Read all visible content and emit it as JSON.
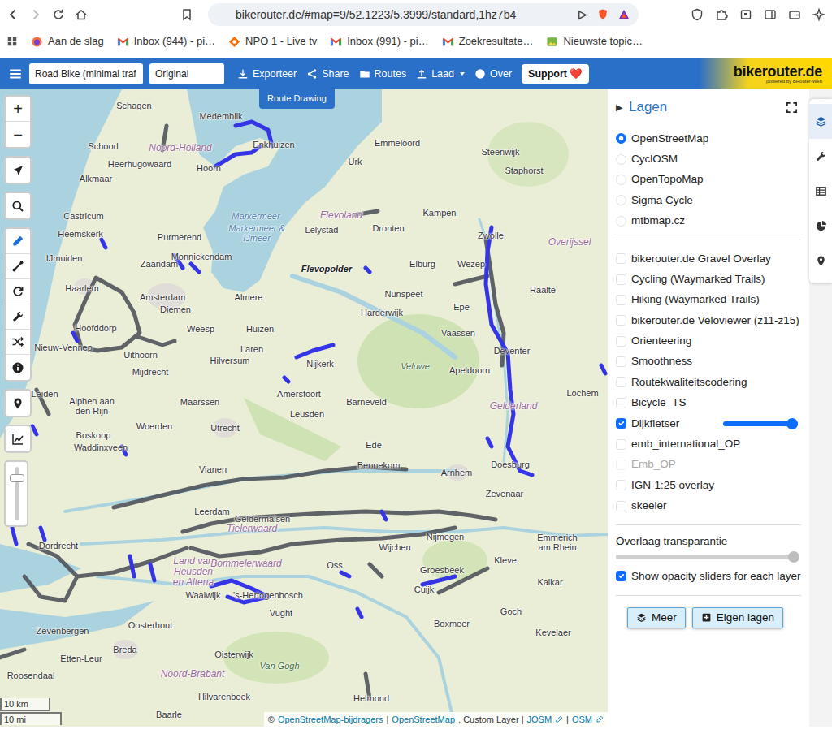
{
  "browser": {
    "url": "bikerouter.de/#map=9/52.1223/5.3999/standard,1hz7b4",
    "bookmarks": [
      {
        "label": "Aan de slag",
        "kind": "firefox"
      },
      {
        "label": "Inbox (944) - pi…",
        "kind": "gmail"
      },
      {
        "label": "NPO 1 - Live tv",
        "kind": "npo"
      },
      {
        "label": "Inbox (991) - pi…",
        "kind": "gmail"
      },
      {
        "label": "Zoekresultate…",
        "kind": "gmail"
      },
      {
        "label": "Nieuwste topic…",
        "kind": "forum"
      }
    ]
  },
  "toolbar": {
    "profile": "Road Bike (minimal traf",
    "style": "Original",
    "menu": [
      {
        "label": "Exporteer"
      },
      {
        "label": "Share"
      },
      {
        "label": "Routes"
      },
      {
        "label": "Laad"
      },
      {
        "label": "Over"
      }
    ],
    "support": "Support",
    "support_icon": "❤️",
    "logo": "bikerouter.de",
    "logo_sub": "powered by BRouter-Web"
  },
  "route_drawing": "Route Drawing",
  "map": {
    "zoom_in": "+",
    "zoom_out": "−",
    "zoom_slider": {
      "level": 0.8
    },
    "draw_tools": [
      {
        "selected": true
      },
      {
        "selected": false
      },
      {
        "selected": false
      },
      {
        "selected": false
      },
      {
        "selected": false
      },
      {
        "selected": false
      }
    ],
    "labels": [
      {
        "text": "Schagen",
        "kind": "place"
      },
      {
        "text": "Medemblik",
        "kind": "place"
      },
      {
        "text": "Enkhuizen",
        "kind": "place"
      },
      {
        "text": "Steenwijk",
        "kind": "place"
      },
      {
        "text": "Schoorl",
        "kind": "place"
      },
      {
        "text": "Noord-Holland",
        "kind": "region"
      },
      {
        "text": "Hoorn",
        "kind": "place"
      },
      {
        "text": "Emmeloord",
        "kind": "place"
      },
      {
        "text": "Urk",
        "kind": "place"
      },
      {
        "text": "Staphorst",
        "kind": "place"
      },
      {
        "text": "Heerhugowaard",
        "kind": "place"
      },
      {
        "text": "Alkmaar",
        "kind": "place"
      },
      {
        "text": "Castricum",
        "kind": "place"
      },
      {
        "text": "Kampen",
        "kind": "place"
      },
      {
        "text": "Markermeer",
        "kind": "water"
      },
      {
        "text": "Markermeer & IJmeer",
        "kind": "water"
      },
      {
        "text": "Flevoland",
        "kind": "region"
      },
      {
        "text": "Lelystad",
        "kind": "place"
      },
      {
        "text": "Dronten",
        "kind": "place"
      },
      {
        "text": "Zwolle",
        "kind": "place"
      },
      {
        "text": "Heemskerk",
        "kind": "place"
      },
      {
        "text": "Purmerend",
        "kind": "place"
      },
      {
        "text": "Overijssel",
        "kind": "region"
      },
      {
        "text": "Monnickendam",
        "kind": "place"
      },
      {
        "text": "IJmuiden",
        "kind": "place"
      },
      {
        "text": "Zaandam",
        "kind": "place"
      },
      {
        "text": "Flevopolder",
        "kind": "polder"
      },
      {
        "text": "Elburg",
        "kind": "place"
      },
      {
        "text": "Wezep",
        "kind": "place"
      },
      {
        "text": "Haarlem",
        "kind": "place"
      },
      {
        "text": "Amsterdam",
        "kind": "place"
      },
      {
        "text": "Almere",
        "kind": "place"
      },
      {
        "text": "Nunspeet",
        "kind": "place"
      },
      {
        "text": "Raalte",
        "kind": "place"
      },
      {
        "text": "Epe",
        "kind": "place"
      },
      {
        "text": "Diemen",
        "kind": "place"
      },
      {
        "text": "Harderwijk",
        "kind": "place"
      },
      {
        "text": "Hoofddorp",
        "kind": "place"
      },
      {
        "text": "Weesp",
        "kind": "place"
      },
      {
        "text": "Huizen",
        "kind": "place"
      },
      {
        "text": "Vaassen",
        "kind": "place"
      },
      {
        "text": "Nieuw-Vennep",
        "kind": "place"
      },
      {
        "text": "Laren",
        "kind": "place"
      },
      {
        "text": "Deventer",
        "kind": "place"
      },
      {
        "text": "Uithoorn",
        "kind": "place"
      },
      {
        "text": "Hilversum",
        "kind": "place"
      },
      {
        "text": "Nijkerk",
        "kind": "place"
      },
      {
        "text": "Veluwe",
        "kind": "park"
      },
      {
        "text": "Apeldoorn",
        "kind": "place"
      },
      {
        "text": "Mijdrecht",
        "kind": "place"
      },
      {
        "text": "Lochem",
        "kind": "place"
      },
      {
        "text": "Leiden",
        "kind": "place"
      },
      {
        "text": "Amersfoort",
        "kind": "place"
      },
      {
        "text": "Alphen aan den Rijn",
        "kind": "place"
      },
      {
        "text": "Maarssen",
        "kind": "place"
      },
      {
        "text": "Barneveld",
        "kind": "place"
      },
      {
        "text": "Gelderland",
        "kind": "region"
      },
      {
        "text": "Leusden",
        "kind": "place"
      },
      {
        "text": "Woerden",
        "kind": "place"
      },
      {
        "text": "Utrecht",
        "kind": "place"
      },
      {
        "text": "Boskoop",
        "kind": "place"
      },
      {
        "text": "Ede",
        "kind": "place"
      },
      {
        "text": "Waddinxveen",
        "kind": "place"
      },
      {
        "text": "Doesburg",
        "kind": "place"
      },
      {
        "text": "Bennekom",
        "kind": "place"
      },
      {
        "text": "Vianen",
        "kind": "place"
      },
      {
        "text": "Arnhem",
        "kind": "place"
      },
      {
        "text": "Zevenaar",
        "kind": "place"
      },
      {
        "text": "Leerdam",
        "kind": "place"
      },
      {
        "text": "Geldermalsen",
        "kind": "place"
      },
      {
        "text": "Tielerwaard",
        "kind": "region"
      },
      {
        "text": "Wijchen",
        "kind": "place"
      },
      {
        "text": "Nijmegen",
        "kind": "place"
      },
      {
        "text": "Emmerich am Rhein",
        "kind": "place"
      },
      {
        "text": "Dordrecht",
        "kind": "place"
      },
      {
        "text": "Land van Heusden en Altena",
        "kind": "region"
      },
      {
        "text": "Bommelerwaard",
        "kind": "region"
      },
      {
        "text": "Oss",
        "kind": "place"
      },
      {
        "text": "Kleve",
        "kind": "place"
      },
      {
        "text": "Groesbeek",
        "kind": "place"
      },
      {
        "text": "Kalkar",
        "kind": "place"
      },
      {
        "text": "Cuijk",
        "kind": "place"
      },
      {
        "text": "Waalwijk",
        "kind": "place"
      },
      {
        "text": "'s-Hertogenbosch",
        "kind": "place"
      },
      {
        "text": "Goch",
        "kind": "place"
      },
      {
        "text": "Vught",
        "kind": "place"
      },
      {
        "text": "Boxmeer",
        "kind": "place"
      },
      {
        "text": "Oosterhout",
        "kind": "place"
      },
      {
        "text": "Zevenbergen",
        "kind": "place"
      },
      {
        "text": "Kevelaer",
        "kind": "place"
      },
      {
        "text": "Breda",
        "kind": "place"
      },
      {
        "text": "Oisterwijk",
        "kind": "place"
      },
      {
        "text": "Etten-Leur",
        "kind": "place"
      },
      {
        "text": "Van Gogh",
        "kind": "park"
      },
      {
        "text": "Noord-Brabant",
        "kind": "region"
      },
      {
        "text": "Roosendaal",
        "kind": "place"
      },
      {
        "text": "Hilvarenbeek",
        "kind": "place"
      },
      {
        "text": "Helmond",
        "kind": "place"
      },
      {
        "text": "Baarle",
        "kind": "place"
      }
    ],
    "scale": {
      "km": "10 km",
      "mi": "10 mi"
    },
    "attribution": [
      {
        "text": "©",
        "kind": "plain"
      },
      {
        "text": "OpenStreetMap-bijdragers",
        "kind": "link"
      },
      {
        "text": "|",
        "kind": "plain"
      },
      {
        "text": "OpenStreetMap",
        "kind": "link"
      },
      {
        "text": ", Custom Layer |",
        "kind": "plain"
      },
      {
        "text": "JOSM",
        "kind": "edit-link"
      },
      {
        "text": "|",
        "kind": "plain"
      },
      {
        "text": "OSM",
        "kind": "edit-link"
      }
    ]
  },
  "layers_panel": {
    "toggle": "▶",
    "title": "Lagen",
    "base_layers": [
      {
        "label": "OpenStreetMap",
        "selected": true
      },
      {
        "label": "CyclOSM",
        "selected": false
      },
      {
        "label": "OpenTopoMap",
        "selected": false
      },
      {
        "label": "Sigma Cycle",
        "selected": false
      },
      {
        "label": "mtbmap.cz",
        "selected": false
      }
    ],
    "overlays": [
      {
        "label": "bikerouter.de Gravel Overlay",
        "kind": "checkbox",
        "checked": false,
        "disabled": false
      },
      {
        "label": "Cycling (Waymarked Trails)",
        "kind": "checkbox",
        "checked": false,
        "disabled": false
      },
      {
        "label": "Hiking (Waymarked Trails)",
        "kind": "checkbox",
        "checked": false,
        "disabled": false
      },
      {
        "label": "bikerouter.de Veloviewer (z11-z15)",
        "kind": "checkbox",
        "checked": false,
        "disabled": false
      },
      {
        "label": "Orienteering",
        "kind": "checkbox",
        "checked": false,
        "disabled": false
      },
      {
        "label": "Smoothness",
        "kind": "checkbox",
        "checked": false,
        "disabled": false
      },
      {
        "label": "Routekwaliteitscodering",
        "kind": "checkbox",
        "checked": false,
        "disabled": false
      },
      {
        "label": "Bicycle_TS",
        "kind": "checkbox",
        "checked": false,
        "disabled": false
      },
      {
        "label": "Dijkfietser",
        "kind": "slider",
        "checked": true,
        "disabled": false,
        "level": 1
      },
      {
        "label": "emb_international_OP",
        "kind": "checkbox",
        "checked": false,
        "disabled": false
      },
      {
        "label": "Emb_OP",
        "kind": "checkbox",
        "checked": false,
        "disabled": true
      },
      {
        "label": "IGN-1:25 overlay",
        "kind": "checkbox",
        "checked": false,
        "disabled": false
      },
      {
        "label": "skeeler",
        "kind": "checkbox",
        "checked": false,
        "disabled": false
      }
    ],
    "transparency": {
      "label": "Overlaag transparantie",
      "level": 1
    },
    "show_sliders": {
      "label": "Show opacity sliders for each layer",
      "checked": true
    },
    "buttons": [
      {
        "label": "Meer"
      },
      {
        "label": "Eigen lagen"
      }
    ]
  },
  "side_tabs": [
    {
      "selected": true
    },
    {
      "selected": false
    },
    {
      "selected": false
    },
    {
      "selected": false
    },
    {
      "selected": false
    }
  ]
}
